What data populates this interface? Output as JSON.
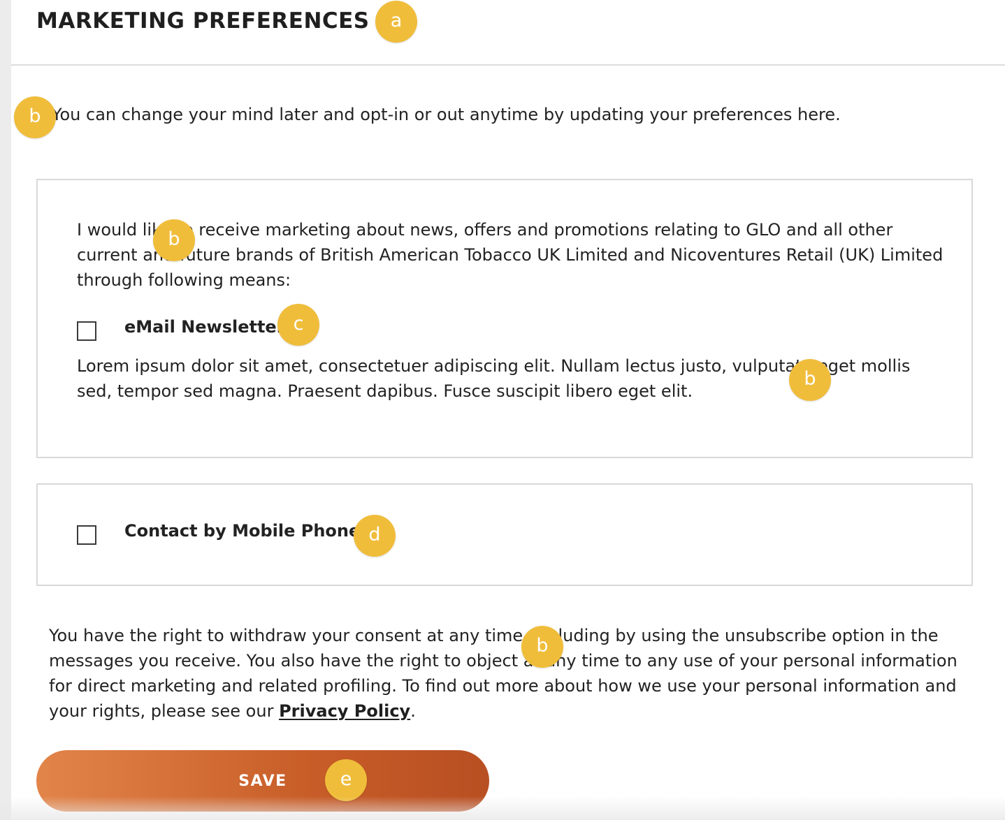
{
  "header": {
    "title": "MARKETING PREFERENCES"
  },
  "intro": {
    "text": "You can change your mind later and opt-in or out anytime by updating your preferences here."
  },
  "email_card": {
    "description": "I would like to receive marketing about news, offers and promotions relating to GLO and all other current and future brands of British American Tobacco UK Limited and Nicoventures Retail (UK) Limited through following means:",
    "option_label": "eMail Newsletter",
    "option_checked": false,
    "option_description": "Lorem ipsum dolor sit amet, consectetuer adipiscing elit. Nullam lectus justo, vulputate eget mollis sed, tempor sed magna. Praesent dapibus. Fusce suscipit libero eget elit."
  },
  "phone_card": {
    "option_label": "Contact by Mobile Phone",
    "option_checked": false
  },
  "rights": {
    "text_before_link": "You have the right to withdraw your consent at any time, including by using the unsubscribe option in the messages you receive. You also have the right to object at any time to any use of your personal information for direct marketing and related profiling. To find out more about how we use your personal information and your rights, please see our ",
    "link_label": "Privacy Policy",
    "text_after_link": "."
  },
  "save_button": {
    "label": "SAVE"
  },
  "annotations": {
    "a": "a",
    "b": "b",
    "c": "c",
    "d": "d",
    "e": "e"
  },
  "colors": {
    "badge": "#f0bd3b",
    "button_gradient_start": "#e2854a",
    "button_gradient_end": "#b84f22",
    "text": "#1f1f1f"
  }
}
